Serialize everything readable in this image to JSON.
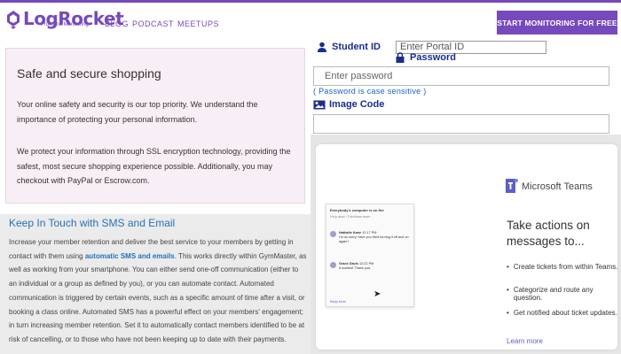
{
  "header": {
    "logo_name": "LogRocket",
    "logo_tagline": "Frontend Monitoring",
    "nav": [
      "BLOG",
      "PODCAST",
      "MEETUPS"
    ],
    "cta_label": "START MONITORING FOR FREE",
    "brand_color": "#764abc"
  },
  "safe": {
    "title": "Safe and secure shopping",
    "para1": "Your online safety and security is our top priority. We understand the importance of protecting your personal information.",
    "para2": "We protect your information through SSL encryption technology, providing the safest, most secure shopping experience possible. Additionally, you may checkout with PayPal or Escrow.com."
  },
  "sms": {
    "title": "Keep In Touch with SMS and Email",
    "text_before": "Increase your member retention and deliver the best service to your members by getting in contact with them using ",
    "link": "automatic SMS and emails",
    "text_after": ". This works directly within GymMaster, as well as working from your smartphone. You can either send one-off communication (either to an individual or a group as defined by you), or you can automate contact. Automated communication is triggered by certain events, such as a specific amount of time after a visit, or booking a class online. Automated SMS has a powerful effect on your members' engagement; in turn increasing member retention. Set it to automatically contact members identified to be at risk of cancelling, or to those who have not been keeping up to date with their payments."
  },
  "login": {
    "student_label": "Student ID",
    "student_placeholder": "Enter Portal ID",
    "password_label": "Password",
    "password_placeholder": "Enter password",
    "password_note": "( Password is case sensitive )",
    "image_code_label": "Image Code",
    "label_color": "#1a2d8f"
  },
  "teams": {
    "brand": "Microsoft Teams",
    "heading": "Take actions on messages to...",
    "bullets": [
      "Create tickets from within Teams.",
      "Categorize and route any question.",
      "Get notified about ticket updates."
    ],
    "learn_more": "Learn more",
    "shot": {
      "title": "Everybody's computer is on fire",
      "subtitle": "Help desk / Fabrikam team",
      "messages": [
        {
          "name": "Nathalie Kane",
          "time": "12:17 PM",
          "text": "I'm so sorry, have you tried turning it off and on again?"
        },
        {
          "name": "Grace Davis",
          "time": "12:22 PM",
          "text": "It worked! Thank you."
        }
      ],
      "actions": "Reply   More"
    },
    "accent": "#5b5fc7"
  }
}
